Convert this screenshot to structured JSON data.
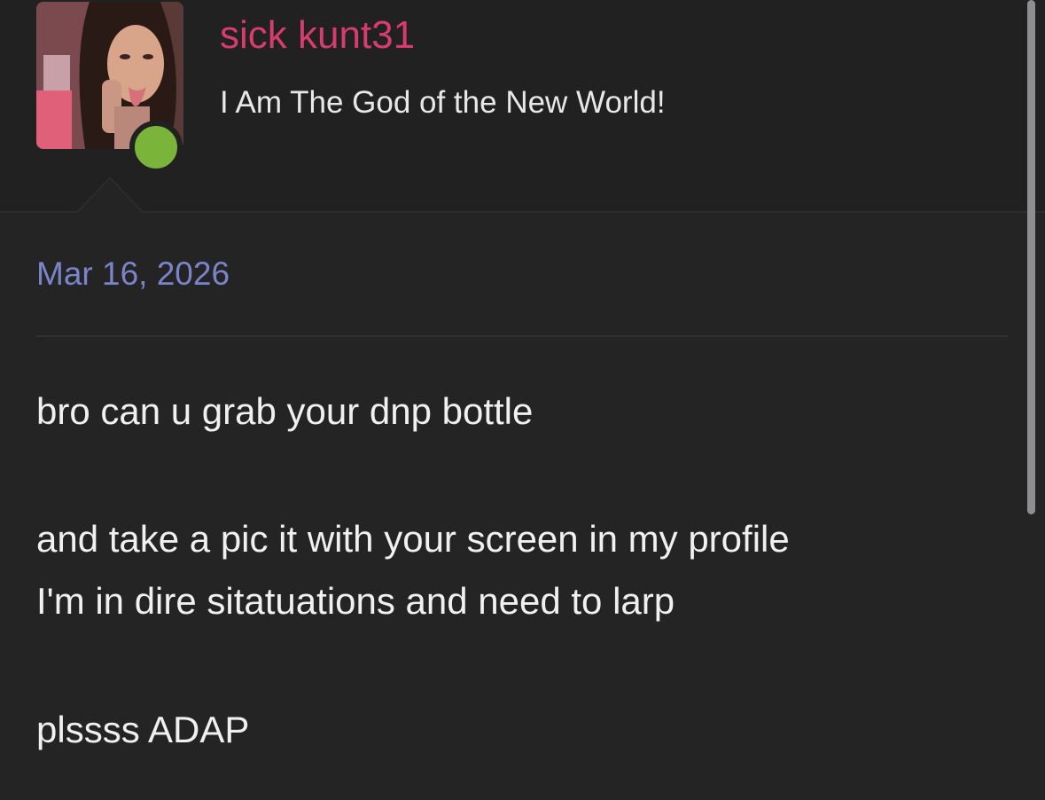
{
  "user": {
    "name": "sick kunt31",
    "title": "I Am The God of the New World!",
    "online": true,
    "avatar_alt": "avatar"
  },
  "post": {
    "date": "Mar 16, 2026",
    "lines": [
      "bro can u grab your dnp bottle",
      "and take a pic it with your screen in my profile",
      "I'm in dire sitatuations and need to larp",
      "plssss ADAP"
    ]
  },
  "colors": {
    "background": "#242425",
    "username": "#d63c6e",
    "date": "#7b84c8",
    "online": "#7bb43a",
    "text": "#f0f0f0"
  }
}
